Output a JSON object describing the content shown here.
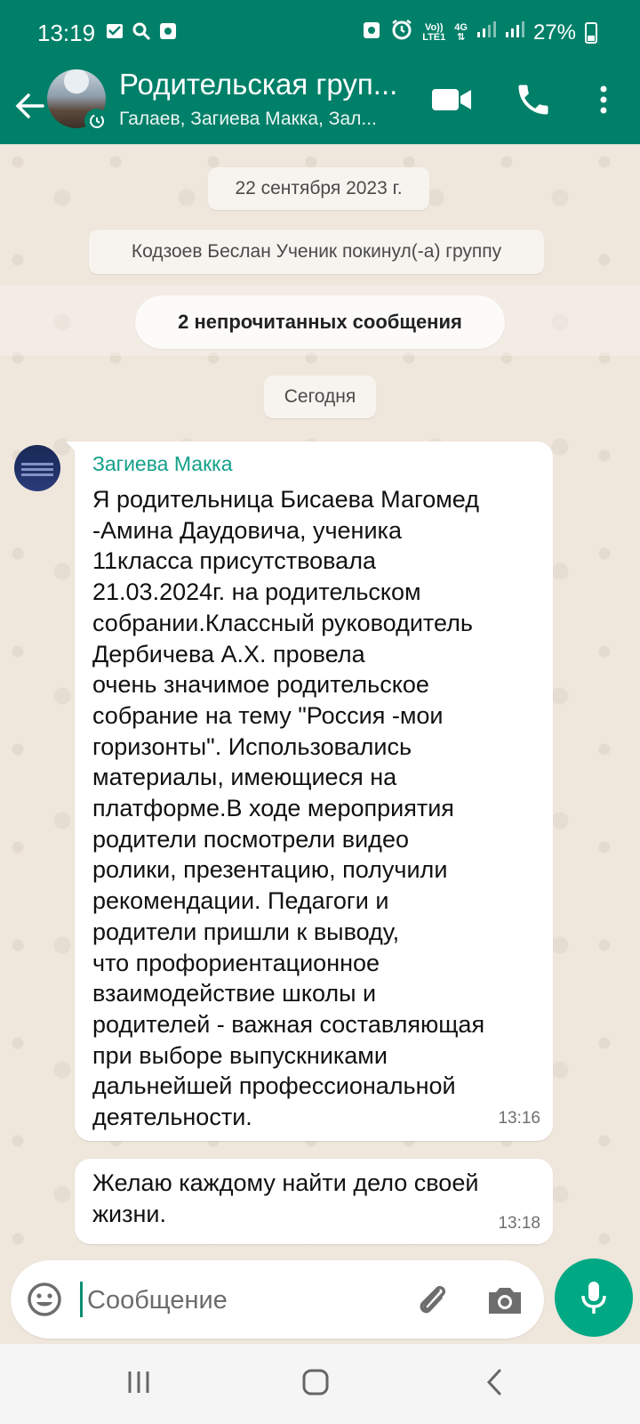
{
  "status_bar": {
    "time": "13:19",
    "network_label_top": "Vo))",
    "network_label_bottom": "LTE1",
    "network_type": "4G",
    "battery": "27%",
    "left_icons": [
      "message-icon",
      "search-icon",
      "screen-recorder-icon"
    ],
    "right_icons": [
      "android-icon",
      "alarm-icon",
      "signal-icon",
      "signal-icon",
      "battery-icon"
    ]
  },
  "header": {
    "title": "Родительская груп...",
    "subtitle": "Галаев, Загиева Макка, Зал...",
    "icons": [
      "back-arrow-icon",
      "video-call-icon",
      "phone-icon",
      "more-vert-icon"
    ]
  },
  "chat": {
    "date_old": "22 сентября 2023 г.",
    "system_message": "Кодзоев Беслан Ученик покинул(-а) группу",
    "unread_banner": "2 непрочитанных сообщения",
    "date_today": "Сегодня",
    "messages": [
      {
        "sender": "Загиева Макка",
        "text": "Я родительница Бисаева Магомед\n-Амина Даудовича, ученика\n11класса присутствовала\n21.03.2024г. на родительском\nсобрании.Классный руководитель\nДербичева А.Х. провела\nочень значимое родительское\nсобрание на тему \"Россия -мои\nгоризонты\". Использовались\nматериалы, имеющиеся на\nплатформе.В ходе мероприятия\nродители посмотрели видео\nролики, презентацию, получили\nрекомендации. Педагоги и\nродители пришли к выводу,\nчто профориентационное\nвзаимодействие школы и\nродителей - важная составляющая\nпри выборе выпускниками\nдальнейшей профессиональной\nдеятельности.",
        "time": "13:16"
      },
      {
        "text": "Желаю каждому найти дело своей\nжизни.",
        "time": "13:18"
      }
    ]
  },
  "composer": {
    "placeholder": "Сообщение",
    "value": "",
    "icons": [
      "emoji-icon",
      "attach-icon",
      "camera-icon",
      "mic-icon"
    ]
  },
  "nav": {
    "icons": [
      "recent-apps-icon",
      "home-icon",
      "back-icon"
    ]
  },
  "colors": {
    "header": "#008069",
    "sender_name": "#13a089",
    "mic_button": "#00a884",
    "chat_background": "#efe6dc"
  }
}
